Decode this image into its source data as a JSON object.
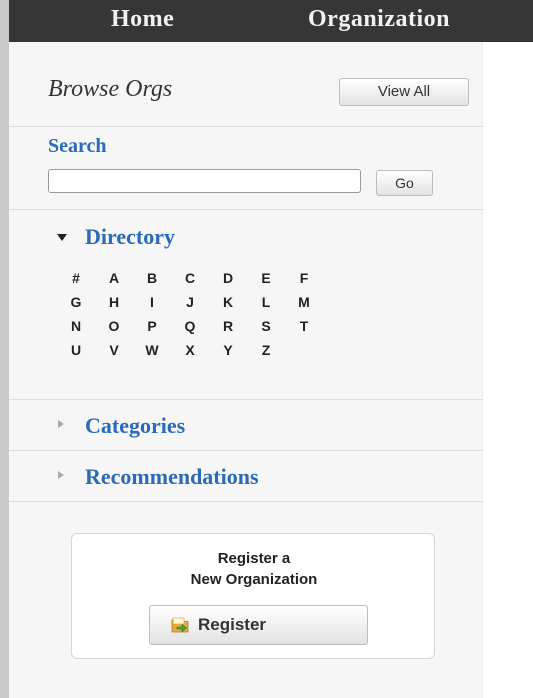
{
  "nav": {
    "home_label": "Home",
    "org_label": "Organization"
  },
  "browse": {
    "title": "Browse Orgs",
    "view_all_label": "View All"
  },
  "search": {
    "label": "Search",
    "value": "",
    "go_label": "Go"
  },
  "directory": {
    "label": "Directory",
    "letters": [
      "#",
      "A",
      "B",
      "C",
      "D",
      "E",
      "F",
      "G",
      "H",
      "I",
      "J",
      "K",
      "L",
      "M",
      "N",
      "O",
      "P",
      "Q",
      "R",
      "S",
      "T",
      "U",
      "V",
      "W",
      "X",
      "Y",
      "Z"
    ]
  },
  "categories": {
    "label": "Categories"
  },
  "recommendations": {
    "label": "Recommendations"
  },
  "register": {
    "line1": "Register a",
    "line2": "New Organization",
    "button_label": "Register",
    "icon": "register-folder-arrow-icon"
  },
  "colors": {
    "link_blue": "#2a6ab8",
    "nav_bar": "#363636",
    "sidebar_bg": "#f6f6f6"
  }
}
